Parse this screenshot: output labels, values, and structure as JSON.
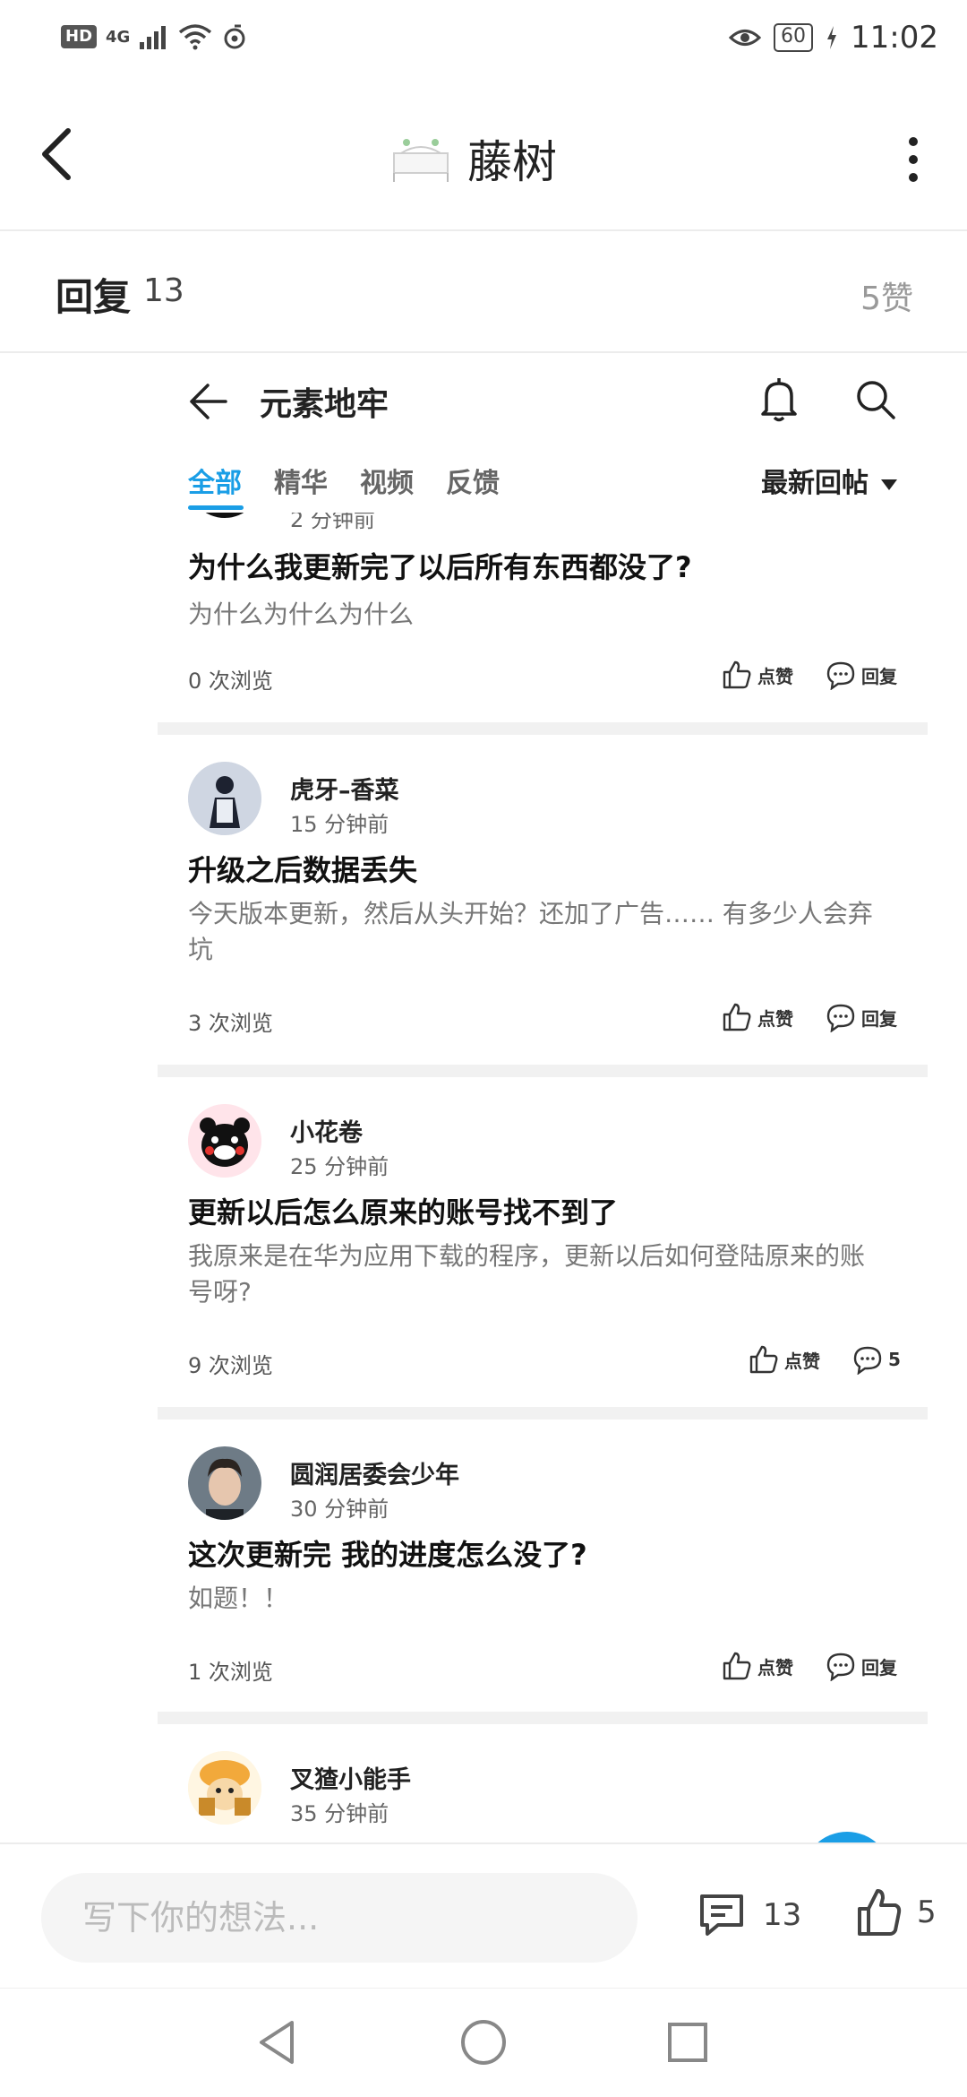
{
  "status_bar": {
    "hd": "HD",
    "network": "4G",
    "battery": "60",
    "time": "11:02"
  },
  "header": {
    "title": "藤树"
  },
  "reply_bar": {
    "label": "回复",
    "count": "13",
    "likes": "5赞"
  },
  "screenshot": {
    "title": "元素地牢",
    "tabs": [
      "全部",
      "精华",
      "视频",
      "反馈"
    ],
    "active_tab": "全部",
    "sort_label": "最新回帖",
    "posts": [
      {
        "username": "",
        "time": "2 分钟前",
        "title": "为什么我更新完了以后所有东西都没了?",
        "body": "为什么为什么为什么",
        "views": "0 次浏览",
        "like_label": "点赞",
        "reply_label": "回复"
      },
      {
        "username": "虎牙–香菜",
        "time": "15 分钟前",
        "title": "升级之后数据丢失",
        "body": "今天版本更新，然后从头开始？还加了广告…… 有多少人会弃坑",
        "views": "3 次浏览",
        "like_label": "点赞",
        "reply_label": "回复"
      },
      {
        "username": "小花卷",
        "time": "25 分钟前",
        "title": "更新以后怎么原来的账号找不到了",
        "body": "我原来是在华为应用下载的程序，更新以后如何登陆原来的账号呀?",
        "views": "9 次浏览",
        "like_label": "点赞",
        "reply_label": "5"
      },
      {
        "username": "圆润居委会少年",
        "time": "30 分钟前",
        "title": "这次更新完 我的进度怎么没了?",
        "body": "如题！！",
        "views": "1 次浏览",
        "like_label": "点赞",
        "reply_label": "回复"
      },
      {
        "username": "叉猹小能手",
        "time": "35 分钟前"
      }
    ]
  },
  "bottom_bar": {
    "placeholder": "写下你的想法...",
    "comments": "13",
    "likes": "5"
  },
  "colors": {
    "accent": "#1a9ee6",
    "separator": "#f1f1f1"
  }
}
